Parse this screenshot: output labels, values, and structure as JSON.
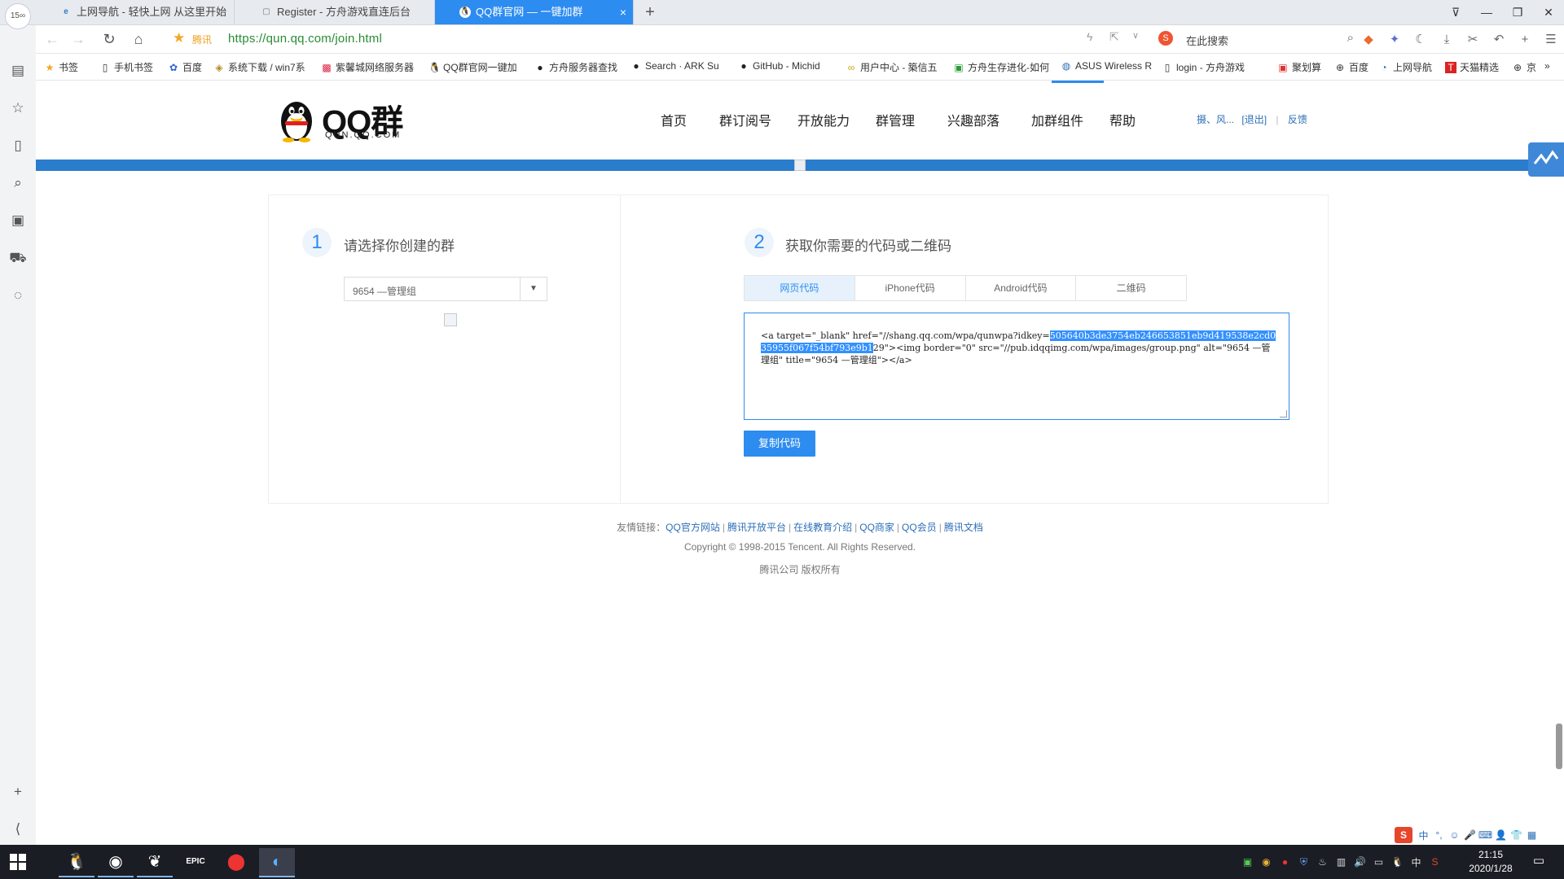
{
  "browser": {
    "tabs": [
      {
        "label": "上网导航 - 轻快上网 从这里开始",
        "icon": "e"
      },
      {
        "label": "Register - 方舟游戏直连后台",
        "icon": "▢"
      },
      {
        "label": "QQ群官网 — 一键加群",
        "icon": "🐧",
        "active": true
      }
    ],
    "new_tab": "+",
    "logo_label": "15∞",
    "address_label": "腾讯",
    "url": "https://qun.qq.com/join.html",
    "search_placeholder": "在此搜索",
    "bookmarks": [
      {
        "label": "书签",
        "icon": "★"
      },
      {
        "label": "手机书签",
        "icon": "▯"
      },
      {
        "label": "百度",
        "icon": "✿"
      },
      {
        "label": "系统下载 / win7系",
        "icon": "◈"
      },
      {
        "label": "紫馨城网络服务器",
        "icon": "▩"
      },
      {
        "label": "QQ群官网一键加",
        "icon": "🐧"
      },
      {
        "label": "方舟服务器查找",
        "icon": "●"
      },
      {
        "label": "Search · ARK Su",
        "icon": "●"
      },
      {
        "label": "GitHub - Michid",
        "icon": "●"
      },
      {
        "label": "用户中心 - 築信五",
        "icon": "∞"
      },
      {
        "label": "方舟生存进化-如何",
        "icon": "▣"
      },
      {
        "label": "ASUS Wireless R",
        "icon": "◍"
      },
      {
        "label": "login - 方舟游戏",
        "icon": "▯"
      },
      {
        "label": "聚划算",
        "icon": "▣"
      },
      {
        "label": "百度",
        "icon": "⊕"
      },
      {
        "label": "上网导航",
        "icon": "◔"
      },
      {
        "label": "天猫精选",
        "icon": "T"
      },
      {
        "label": "京",
        "icon": "⊕"
      }
    ]
  },
  "site": {
    "brand": "QQ群",
    "brand_sub": "QUN.QQ.COM",
    "nav": [
      "首页",
      "群订阅号",
      "开放能力",
      "群管理",
      "兴趣部落",
      "加群组件",
      "帮助"
    ],
    "user_name": "摄、风...",
    "logout": "[退出]",
    "feedback": "反馈"
  },
  "step1": {
    "number": "1",
    "title": "请选择你创建的群",
    "selected_group": "9654 —管理组"
  },
  "step2": {
    "number": "2",
    "title": "获取你需要的代码或二维码",
    "tabs": [
      "网页代码",
      "iPhone代码",
      "Android代码",
      "二维码"
    ],
    "code_part1": "<a target=\"_blank\" href=\"//shang.qq.com/wpa/qunwpa?idkey=",
    "code_highlight": "505640b3de3754eb246653851eb9d419538e2cd035955f067f54bf793e9b1",
    "code_part2": "29\"><img border=\"0\" src=\"//pub.idqqimg.com/wpa/images/group.png\" alt=\"9654 —管理组\" title=\"9654 —管理组\"></a>",
    "copy_button": "复制代码"
  },
  "footer": {
    "links_label": "友情链接：",
    "links": [
      "QQ官方网站",
      "腾讯开放平台",
      "在线教育介绍",
      "QQ商家",
      "QQ会员",
      "腾讯文档"
    ],
    "copyright": "Copyright © 1998-2015 Tencent. All Rights Reserved.",
    "company": "腾讯公司 版权所有"
  },
  "ime": {
    "logo": "S",
    "mode": "中"
  },
  "taskbar": {
    "time": "21:15",
    "date": "2020/1/28",
    "tray_lang": "中"
  },
  "colors": {
    "accent": "#2d8cf0",
    "banner_blue": "#2a7ccc",
    "url_green": "#2a8c34"
  }
}
